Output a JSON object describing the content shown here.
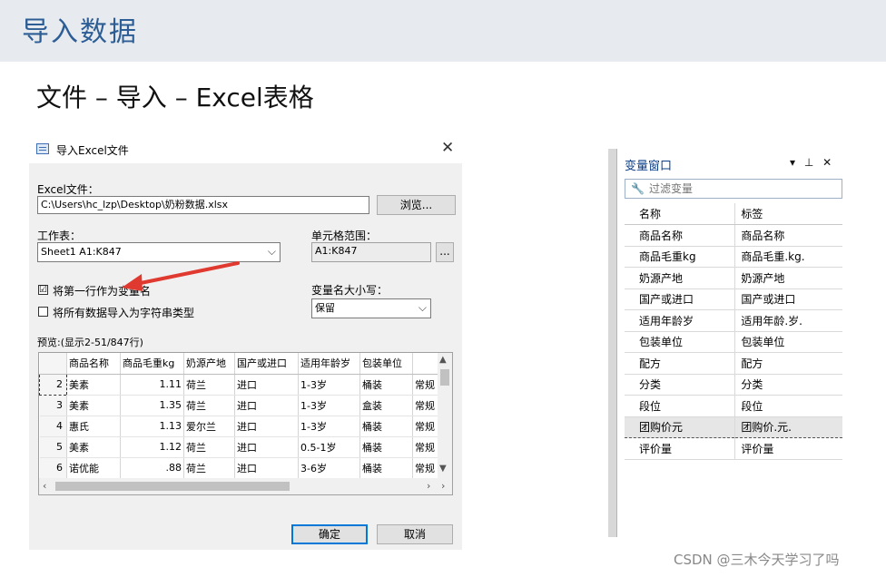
{
  "slide": {
    "title": "导入数据",
    "subtitle": "文件 – 导入 – Excel表格"
  },
  "dialog": {
    "title": "导入Excel文件",
    "close_glyph": "✕",
    "file_label": "Excel文件：",
    "file_path": "C:\\Users\\hc_lzp\\Desktop\\奶粉数据.xlsx",
    "browse_label": "浏览...",
    "sheet_label": "工作表：",
    "sheet_value": "Sheet1 A1:K847",
    "range_label": "单元格范围：",
    "range_value": "A1:K847",
    "range_btn": "...",
    "first_row_label": "将第一行作为变量名",
    "first_row_checked": "☑",
    "all_string_label": "将所有数据导入为字符串类型",
    "case_label": "变量名大小写：",
    "case_value": "保留",
    "preview_label": "预览:(显示2-51/847行)",
    "ok_label": "确定",
    "cancel_label": "取消",
    "grid": {
      "headers": [
        "商品名称",
        "商品毛重kg",
        "奶源产地",
        "国产或进口",
        "适用年龄岁",
        "包装单位",
        ""
      ],
      "rows": [
        [
          "2",
          "美素",
          "1.11",
          "荷兰",
          "进口",
          "1-3岁",
          "桶装",
          "常规"
        ],
        [
          "3",
          "美素",
          "1.35",
          "荷兰",
          "进口",
          "1-3岁",
          "盒装",
          "常规"
        ],
        [
          "4",
          "惠氏",
          "1.13",
          "爱尔兰",
          "进口",
          "1-3岁",
          "桶装",
          "常规"
        ],
        [
          "5",
          "美素",
          "1.12",
          "荷兰",
          "进口",
          "0.5-1岁",
          "桶装",
          "常规"
        ],
        [
          "6",
          "诺优能",
          ".88",
          "荷兰",
          "进口",
          "3-6岁",
          "桶装",
          "常规"
        ]
      ]
    }
  },
  "var_window": {
    "title": "变量窗口",
    "pin_btns": [
      "ᛏ",
      "ꟷ",
      "✕"
    ],
    "filter_placeholder": "过滤变量",
    "col_name": "名称",
    "col_label": "标签",
    "rows": [
      {
        "name": "商品名称",
        "label": "商品名称"
      },
      {
        "name": "商品毛重kg",
        "label": "商品毛重.kg."
      },
      {
        "name": "奶源产地",
        "label": "奶源产地"
      },
      {
        "name": "国产或进口",
        "label": "国产或进口"
      },
      {
        "name": "适用年龄岁",
        "label": "适用年龄.岁."
      },
      {
        "name": "包装单位",
        "label": "包装单位"
      },
      {
        "name": "配方",
        "label": "配方"
      },
      {
        "name": "分类",
        "label": "分类"
      },
      {
        "name": "段位",
        "label": "段位"
      },
      {
        "name": "团购价元",
        "label": "团购价.元."
      },
      {
        "name": "评价量",
        "label": "评价量"
      }
    ]
  },
  "watermark": "CSDN @三木今天学习了吗",
  "colors": {
    "title_blue": "#2c5d95",
    "header_bg": "#e7ebef",
    "annotation_arrow": "#e03a30",
    "dialog_bg": "#f0f0f0"
  }
}
